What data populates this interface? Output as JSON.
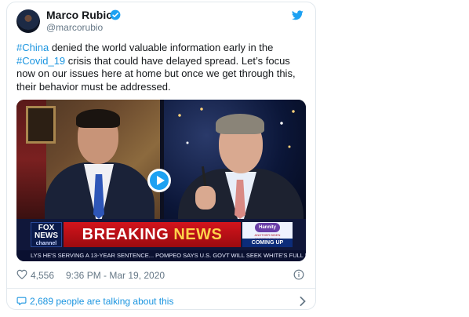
{
  "tweet": {
    "author_name": "Marco Rubio",
    "author_handle": "@marcorubio",
    "text_parts": {
      "tag1": "#China",
      "t1": " denied the world valuable information early in the ",
      "tag2": "#Covid_19",
      "t2": " crisis that could have delayed spread. Let’s focus now on our issues here at home but once we get through this, their behavior must be addressed."
    },
    "likes": "4,556",
    "timestamp": "9:36 PM - Mar 19, 2020",
    "conversation": "2,689 people are talking about this"
  },
  "video": {
    "network_logo": "FOX NEWS",
    "network_sub": "channel",
    "breaking_text": "BREAKING",
    "news_text": "NEWS",
    "show_logo": "Hannity",
    "show_sub": "ANOTHER BIDEN INVESTIGATION?",
    "coming_up": "COMING UP",
    "ticker": "LYS HE'S SERVING A 13-YEAR SENTENCE...   POMPEO SAYS U.S. GOVT WILL SEEK WHITE'S FULL RELEASE, A"
  },
  "colors": {
    "link": "#1b95e0",
    "verified": "#1da1f2",
    "breaking_red": "#d3141c",
    "news_yellow": "#ffd24a"
  },
  "icons": [
    "verified-icon",
    "twitter-bird-icon",
    "play-icon",
    "heart-icon",
    "info-icon",
    "reply-bubble-icon",
    "chevron-right-icon"
  ]
}
